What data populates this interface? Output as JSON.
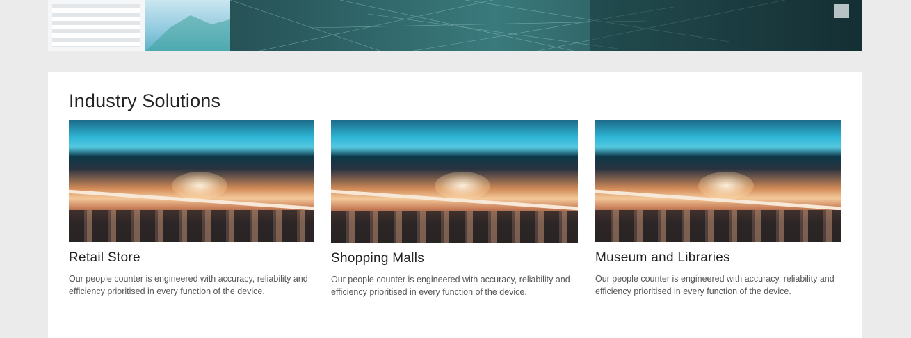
{
  "hero": {
    "image_name": "analytics-dashboard-banner"
  },
  "section": {
    "title": "Industry Solutions"
  },
  "solutions": [
    {
      "title": "Retail Store",
      "description": "Our people counter is engineered with accuracy, reliability and efficiency prioritised in every function of the device.",
      "image_name": "shopping-mall-interior-photo"
    },
    {
      "title": "Shopping Malls",
      "description": "Our people counter is engineered with accuracy, reliability and efficiency prioritised in every function of the device.",
      "image_name": "shopping-mall-interior-photo"
    },
    {
      "title": "Museum and Libraries",
      "description": "Our people counter is engineered with accuracy, reliability and efficiency prioritised in every function of the device.",
      "image_name": "shopping-mall-interior-photo"
    }
  ],
  "colors": {
    "page_background": "#ebebeb",
    "card_background": "#ffffff",
    "heading_text": "#222222",
    "body_text": "#555555"
  }
}
